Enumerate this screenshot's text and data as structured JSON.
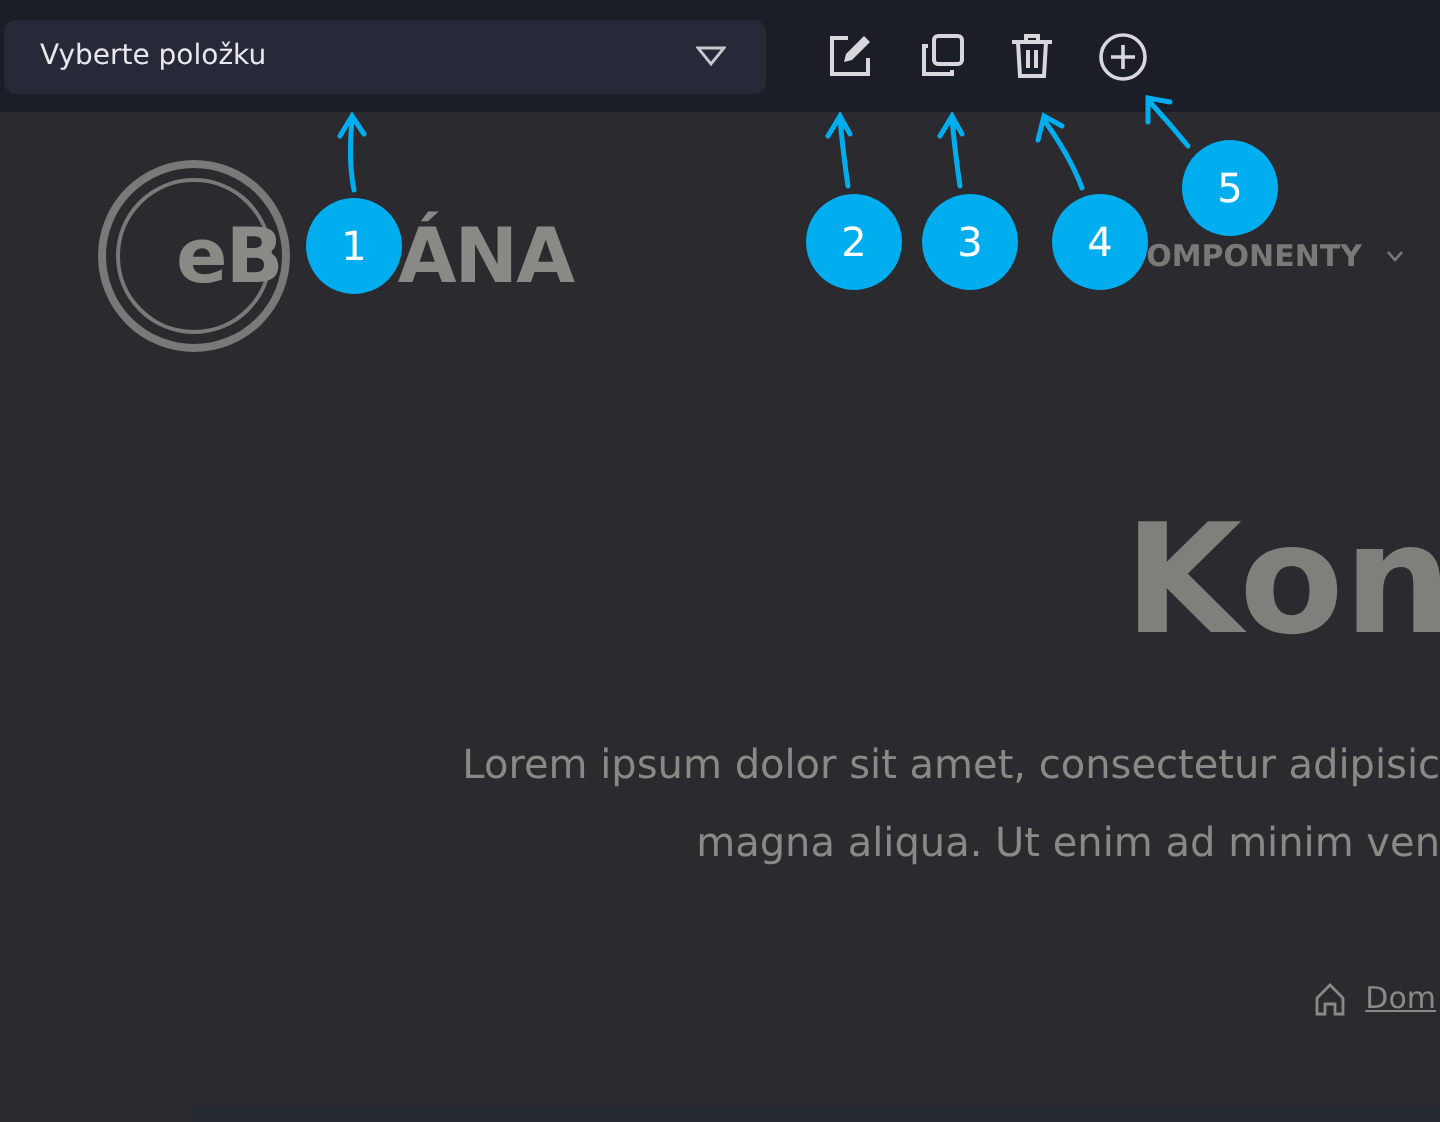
{
  "toolbar": {
    "dropdown": {
      "placeholder": "Vyberte položku"
    },
    "tools": [
      {
        "kind": "edit"
      },
      {
        "kind": "copy"
      },
      {
        "kind": "delete"
      },
      {
        "kind": "add"
      }
    ]
  },
  "header": {
    "logo_parts": [
      "eB",
      "ÁNA"
    ],
    "nav": [
      {
        "label": "OMPONENTY"
      }
    ]
  },
  "hero": {
    "title": "Kon",
    "lines": [
      "Lorem ipsum dolor sit amet, consectetur adipisic",
      "magna aliqua. Ut enim ad minim ven"
    ]
  },
  "breadcrumb": {
    "label": "Dom"
  },
  "callouts": [
    {
      "number": "1"
    },
    {
      "number": "2"
    },
    {
      "number": "3"
    },
    {
      "number": "4"
    },
    {
      "number": "5"
    }
  ]
}
